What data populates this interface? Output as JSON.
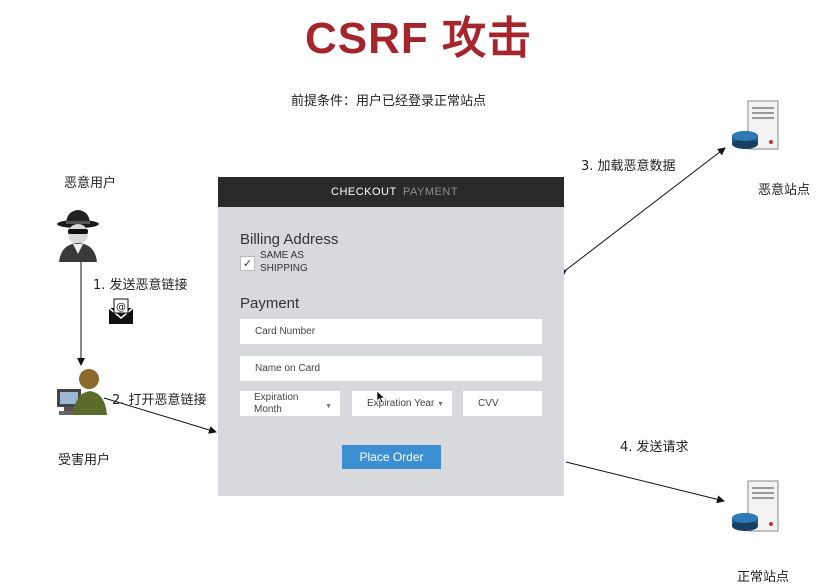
{
  "title": "CSRF 攻击",
  "precondition": "前提条件：用户已经登录正常站点",
  "attacker": {
    "label": "恶意用户"
  },
  "victim": {
    "label": "受害用户"
  },
  "malicious_site": {
    "label": "恶意站点"
  },
  "normal_site": {
    "label": "正常站点"
  },
  "steps": {
    "step1": "1. 发送恶意链接",
    "step2": "2. 打开恶意链接",
    "step3": "3. 加载恶意数据",
    "step4": "4. 发送请求"
  },
  "form": {
    "tabs": {
      "checkout": "CHECKOUT",
      "payment": "PAYMENT"
    },
    "billing_heading": "Billing Address",
    "same_as_line1": "SAME AS",
    "same_as_line2": "SHIPPING",
    "same_as_checked": true,
    "payment_heading": "Payment",
    "card_number_placeholder": "Card Number",
    "name_on_card_placeholder": "Name on Card",
    "expiration_month_line1": "Expiration",
    "expiration_month_line2": "Month",
    "expiration_year": "Expiration Year",
    "cvv_placeholder": "CVV",
    "place_order": "Place Order"
  }
}
